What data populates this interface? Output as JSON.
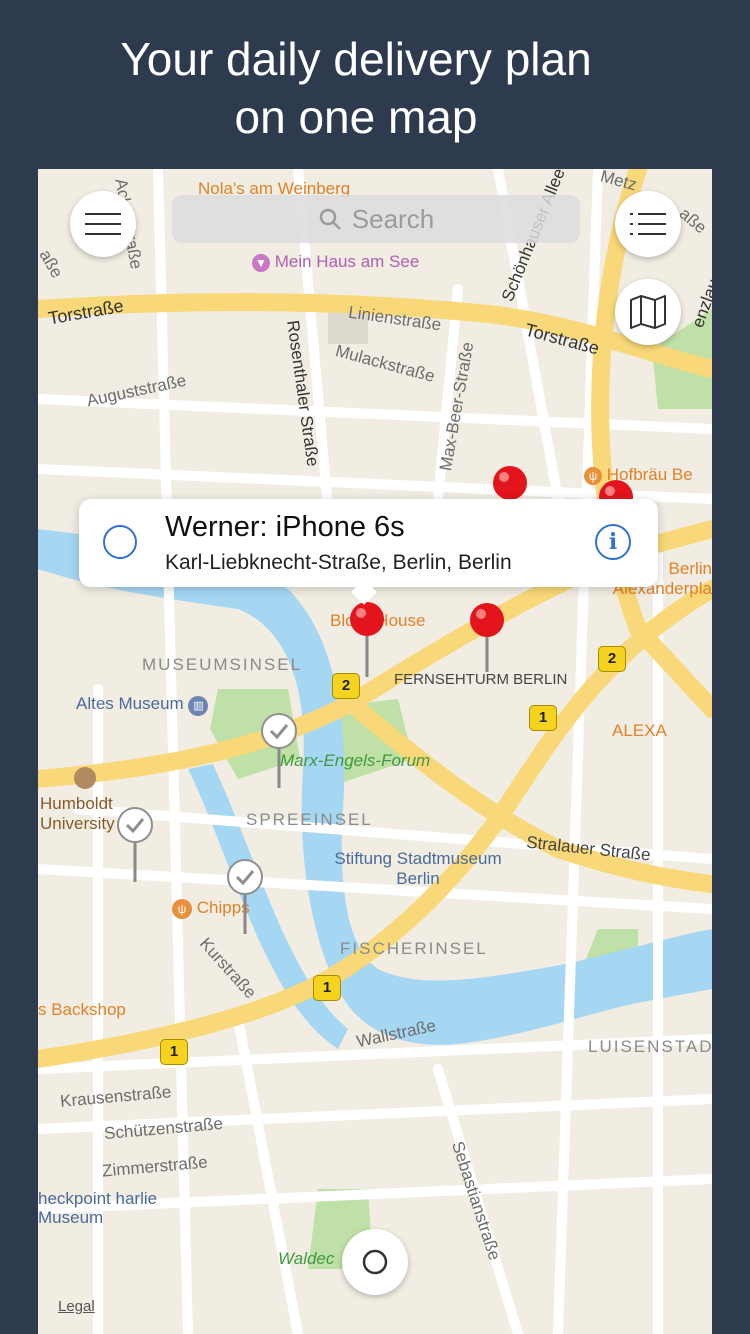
{
  "headline": {
    "line1": "Your daily delivery plan",
    "line2": "on one map"
  },
  "search": {
    "placeholder": "Search",
    "icon": "search-icon"
  },
  "buttons": {
    "menu": "hamburger-menu-icon",
    "list": "list-icon",
    "map_mode": "map-icon",
    "locate": "location-icon"
  },
  "callout": {
    "title": "Werner: iPhone 6s",
    "address": "Karl-Liebknecht-Straße, Berlin, Berlin",
    "info": "i"
  },
  "streets": {
    "ackerstrasse": "Ackerstraße",
    "torstrasse_left": "Torstraße",
    "torstrasse_right": "Torstraße",
    "linienstrasse": "Linienstraße",
    "mulackstrasse": "Mulackstraße",
    "augustrasse": "Auguststraße",
    "rosenthaler": "Rosenthaler Straße",
    "maxbeer": "Max-Beer-Straße",
    "schoenhauser": "Schönhauser Allee",
    "stralauer": "Stralauer Straße",
    "kurstrasse": "Kurstraße",
    "wallstrasse": "Wallstraße",
    "krausenstrasse": "Krausenstraße",
    "schuetzenstrasse": "Schützenstraße",
    "zimmerstrasse": "Zimmerstraße",
    "sebastianstrasse": "Sebastianstraße",
    "left_edge": "aße",
    "top_right_a": "Metz",
    "top_right_b": "aße",
    "right_edge": "enzlaue"
  },
  "pois": {
    "nolas": "Nola's am Weinberg",
    "mein_haus": "Mein Haus am See",
    "hofbraeu": "Hofbräu Be",
    "blockhouse": "Block House",
    "fernsehturm": "FERNSEHTURM BERLIN",
    "altes_museum": "Altes Museum",
    "humboldt": "Humboldt University",
    "marx_engels": "Marx-Engels-Forum",
    "stiftung": "Stiftung Stadtmuseum Berlin",
    "chipps": "Chipps",
    "backshop": "s Backshop",
    "alexa": "ALEXA",
    "alexanderplatz": "Berlin Alexanderpla",
    "checkpoint": "heckpoint harlie Museum",
    "waldeck": "Waldec"
  },
  "districts": {
    "museumsinsel": "MUSEUMSINSEL",
    "spreeinsel": "SPREEINSEL",
    "fischerinsel": "FISCHERINSEL",
    "luisenstadt": "LUISENSTAD"
  },
  "road_shields": [
    "2",
    "2",
    "1",
    "1",
    "1"
  ],
  "legal": "Legal",
  "colors": {
    "background": "#2e3a4e",
    "pin_red": "#e3141b",
    "water": "#a5d6f2",
    "park": "#bfe0a6",
    "road_major": "#f8d878",
    "accent_blue": "#2f6fd6"
  }
}
